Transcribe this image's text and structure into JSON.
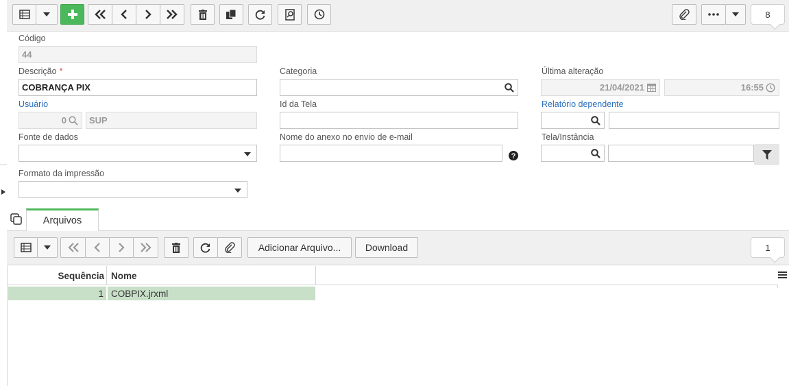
{
  "toolbar": {
    "icons": [
      "grid-view-icon",
      "dropdown-caret-icon",
      "add-icon",
      "first-icon",
      "previous-icon",
      "next-icon",
      "last-icon",
      "delete-icon",
      "copy-icon",
      "refresh-icon",
      "search-document-icon",
      "history-clock-icon",
      "attachment-icon",
      "more-icon",
      "dropdown-caret-icon"
    ],
    "record_count": "8",
    "green": "#4cb85c"
  },
  "form": {
    "codigo": {
      "label": "Código",
      "value": "44"
    },
    "descricao": {
      "label": "Descrição",
      "required": "*",
      "value": "COBRANÇA PIX"
    },
    "categoria": {
      "label": "Categoria",
      "value": ""
    },
    "ultima_alteracao": {
      "label": "Última alteração",
      "date": "21/04/2021",
      "time": "16:55"
    },
    "usuario": {
      "label": "Usuário",
      "id": "0",
      "name": "SUP"
    },
    "id_tela": {
      "label": "Id da Tela",
      "value": ""
    },
    "relatorio_dependente": {
      "label": "Relatório dependente",
      "value": ""
    },
    "fonte_dados": {
      "label": "Fonte de dados",
      "value": ""
    },
    "nome_anexo": {
      "label": "Nome do anexo no envio de e-mail",
      "value": ""
    },
    "tela_instancia": {
      "label": "Tela/Instância",
      "value": ""
    },
    "formato_impressao": {
      "label": "Formato da impressão",
      "value": ""
    }
  },
  "tab": {
    "label": "Arquivos"
  },
  "files_toolbar": {
    "add_file_label": "Adicionar Arquivo...",
    "download_label": "Download",
    "record_count": "1"
  },
  "grid": {
    "columns": [
      "Sequência",
      "Nome"
    ],
    "rows": [
      {
        "sequencia": "1",
        "nome": "COBPIX.jrxml"
      }
    ],
    "selected_color": "#c8dfc8"
  }
}
